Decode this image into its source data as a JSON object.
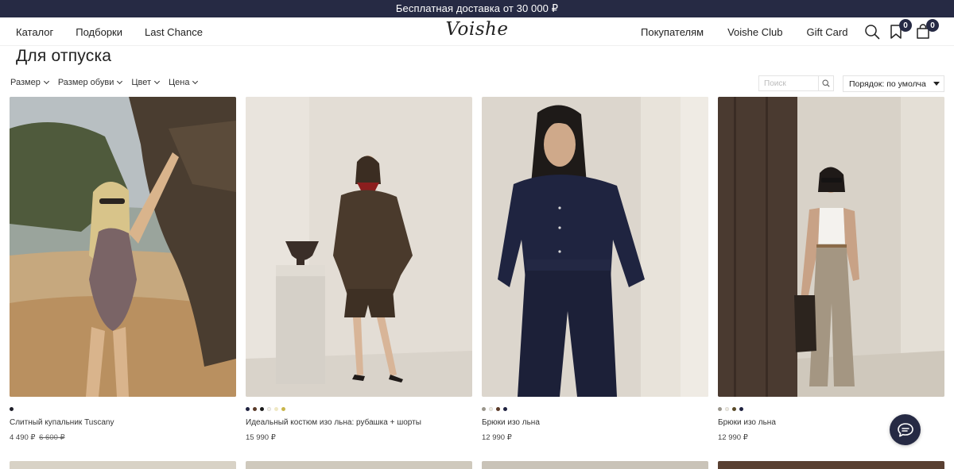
{
  "promo": {
    "text": "Бесплатная доставка от 30 000 ₽"
  },
  "header": {
    "nav_left": [
      "Каталог",
      "Подборки",
      "Last Chance"
    ],
    "logo": "Voishe",
    "nav_right": [
      "Покупателям",
      "Voishe Club",
      "Gift Card"
    ],
    "favorites_count": "0",
    "cart_count": "0"
  },
  "page": {
    "title": "Для отпуска"
  },
  "filters": [
    "Размер",
    "Размер обуви",
    "Цвет",
    "Цена"
  ],
  "search": {
    "placeholder": "Поиск"
  },
  "sort": {
    "label": "Порядок: по умолчанию"
  },
  "products": [
    {
      "name": "Слитный купальник Tuscany",
      "price": "4 490 ₽",
      "old_price": "6 600 ₽",
      "swatches": [
        "#1f1f2a"
      ]
    },
    {
      "name": "Идеальный костюм изо льна: рубашка + шорты",
      "price": "15 990 ₽",
      "old_price": "",
      "swatches": [
        "#1f2240",
        "#5a3a28",
        "#1a1a1a",
        "#f2efe6",
        "#efe8c4",
        "#c9b64a"
      ]
    },
    {
      "name": "Брюки изо льна",
      "price": "12 990 ₽",
      "old_price": "",
      "swatches": [
        "#9a968c",
        "#ece8de",
        "#5a3a28",
        "#1f2240"
      ]
    },
    {
      "name": "Брюки изо льна",
      "price": "12 990 ₽",
      "old_price": "",
      "swatches": [
        "#9a968c",
        "#ece8de",
        "#5a4a28",
        "#1f2240"
      ]
    }
  ],
  "colors": {
    "brand_dark": "#262a44"
  }
}
